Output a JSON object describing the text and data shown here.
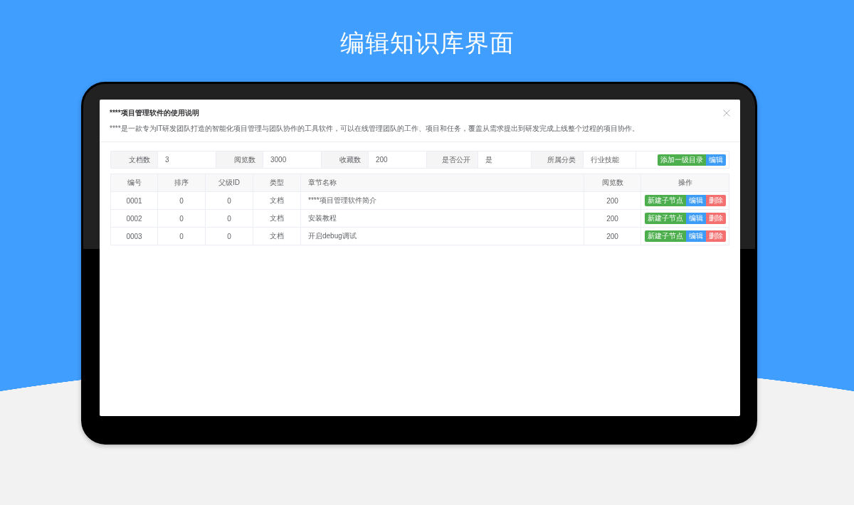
{
  "heading": "编辑知识库界面",
  "dialog": {
    "title": "****项目管理软件的使用说明",
    "description": "****是一款专为IT研发团队打造的智能化项目管理与团队协作的工具软件，可以在线管理团队的工作、项目和任务，覆盖从需求提出到研发完成上线整个过程的项目协作。"
  },
  "summary": {
    "fields": [
      {
        "label": "文档数",
        "value": "3"
      },
      {
        "label": "阅览数",
        "value": "3000"
      },
      {
        "label": "收藏数",
        "value": "200"
      },
      {
        "label": "是否公开",
        "value": "是"
      },
      {
        "label": "所属分类",
        "value": "行业技能"
      }
    ],
    "buttons": [
      {
        "label": "添加一级目录",
        "kind": "success"
      },
      {
        "label": "编辑",
        "kind": "primary"
      }
    ]
  },
  "table": {
    "columns": [
      "编号",
      "排序",
      "父级ID",
      "类型",
      "章节名称",
      "阅览数",
      "操作"
    ],
    "rows": [
      {
        "cells": [
          "0001",
          "0",
          "0",
          "文档",
          "****项目管理软件简介",
          "200"
        ],
        "actions": [
          {
            "label": "新建子节点",
            "kind": "success"
          },
          {
            "label": "编辑",
            "kind": "primary"
          },
          {
            "label": "删除",
            "kind": "danger"
          }
        ]
      },
      {
        "cells": [
          "0002",
          "0",
          "0",
          "文档",
          "安装教程",
          "200"
        ],
        "actions": [
          {
            "label": "新建子节点",
            "kind": "success"
          },
          {
            "label": "编辑",
            "kind": "primary"
          },
          {
            "label": "删除",
            "kind": "danger"
          }
        ]
      },
      {
        "cells": [
          "0003",
          "0",
          "0",
          "文档",
          "开启debug调试",
          "200"
        ],
        "actions": [
          {
            "label": "新建子节点",
            "kind": "success"
          },
          {
            "label": "编辑",
            "kind": "primary"
          },
          {
            "label": "删除",
            "kind": "danger"
          }
        ]
      }
    ]
  }
}
